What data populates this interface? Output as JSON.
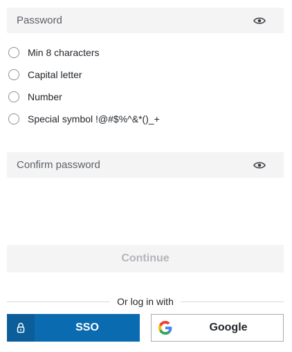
{
  "password": {
    "placeholder": "Password",
    "value": "",
    "toggle_icon": "eye-icon"
  },
  "requirements": [
    {
      "label": "Min 8 characters",
      "met": false
    },
    {
      "label": "Capital letter",
      "met": false
    },
    {
      "label": "Number",
      "met": false
    },
    {
      "label": "Special symbol !@#$%^&*()_+",
      "met": false
    }
  ],
  "confirm_password": {
    "placeholder": "Confirm password",
    "value": "",
    "toggle_icon": "eye-icon"
  },
  "continue_button": {
    "label": "Continue",
    "disabled": true
  },
  "divider_text": "Or log in with",
  "social": {
    "sso_label": "SSO",
    "sso_icon": "lock-icon",
    "google_label": "Google",
    "google_icon": "google-icon"
  },
  "colors": {
    "sso_background": "#0a6bb0",
    "field_background": "#f4f4f4",
    "disabled_text": "#b3b6ba"
  }
}
